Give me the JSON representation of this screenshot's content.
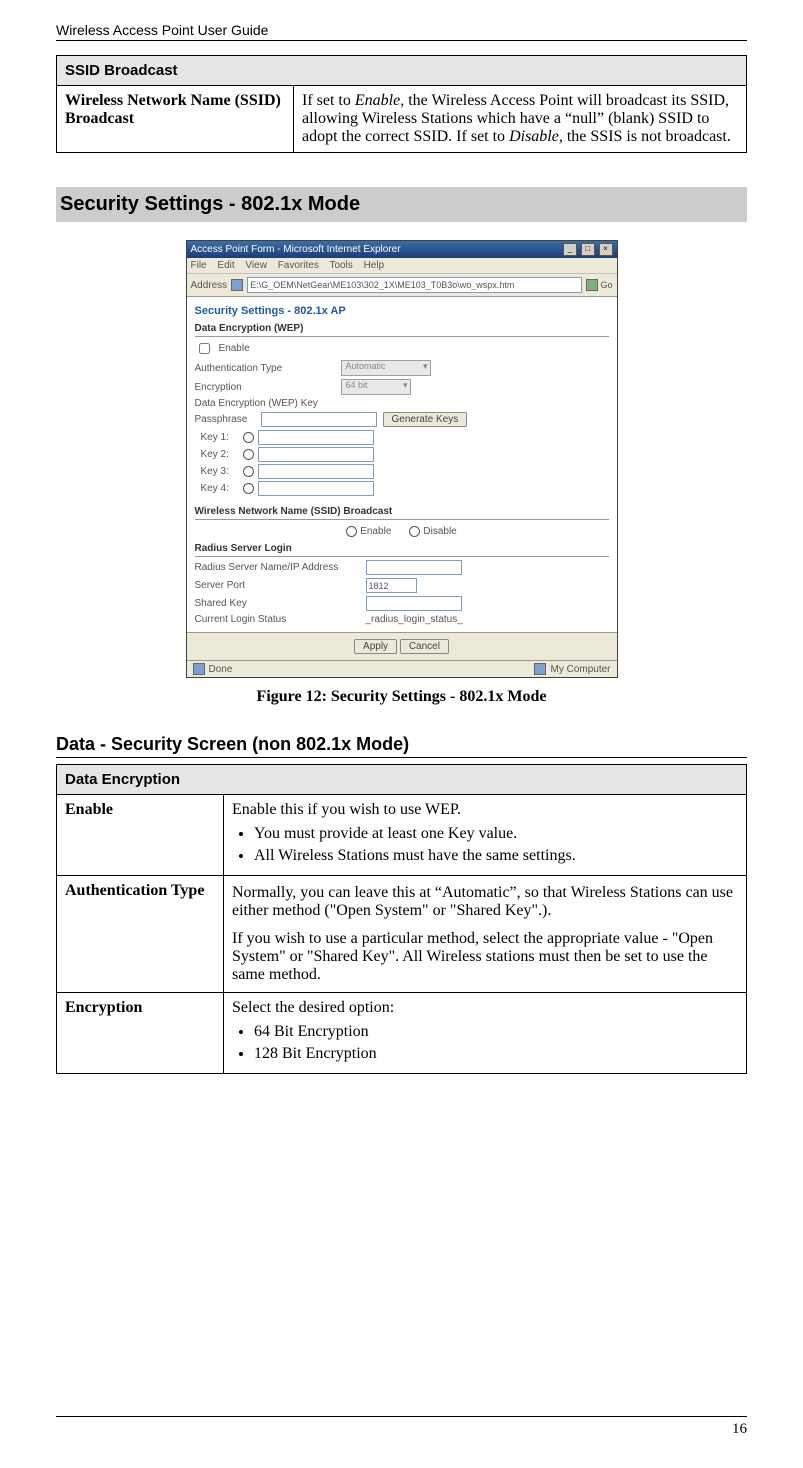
{
  "header": {
    "title": "Wireless Access Point User Guide"
  },
  "footer": {
    "page_number": "16"
  },
  "table1": {
    "section_header": "SSID Broadcast",
    "row": {
      "label": "Wireless Network Name (SSID) Broadcast",
      "desc1": "If set to ",
      "desc_em1": "Enable",
      "desc2": ", the Wireless Access Point will broadcast its SSID, allowing Wireless Stations which have a “null” (blank) SSID to adopt the correct SSID. If set to ",
      "desc_em2": "Disable",
      "desc3": ", the SSIS is not broadcast."
    }
  },
  "heading1": "Security Settings - 802.1x Mode",
  "figure_caption": "Figure 12: Security Settings - 802.1x Mode",
  "heading2": "Data - Security Screen (non 802.1x Mode)",
  "table2": {
    "section_header": "Data Encryption",
    "rows": {
      "enable": {
        "label": "Enable",
        "intro": "Enable this if you wish to use WEP.",
        "b1": "You must provide at least one Key value.",
        "b2": "All Wireless Stations must have the same settings."
      },
      "auth": {
        "label": "Authentication Type",
        "p1": "Normally, you can leave this at “Automatic”, so that Wireless Stations can use either method (\"Open System\" or \"Shared Key\".).",
        "p2": "If you wish to use a particular method, select the appropriate value - \"Open System\" or \"Shared Key\". All Wireless stations must then be set to use the same method."
      },
      "enc": {
        "label": "Encryption",
        "intro": "Select the desired option:",
        "b1": "64 Bit Encryption",
        "b2": "128 Bit Encryption"
      }
    }
  },
  "screenshot": {
    "title": "Access Point Form - Microsoft Internet Explorer",
    "menu": {
      "file": "File",
      "edit": "Edit",
      "view": "View",
      "favorites": "Favorites",
      "tools": "Tools",
      "help": "Help"
    },
    "address_label": "Address",
    "address_value": "E:\\G_OEM\\NetGear\\ME103\\302_1X\\ME103_T0B3o\\wo_wspx.htm",
    "go_label": "Go",
    "section_title": "Security Settings - 802.1x AP",
    "group_data_enc": "Data Encryption (WEP)",
    "enable_label": "Enable",
    "auth_type_label": "Authentication Type",
    "auth_value": "Automatic",
    "encryption_label": "Encryption",
    "encryption_value": "64 bit",
    "wep_key_label": "Data Encryption (WEP) Key",
    "passphrase_label": "Passphrase",
    "generate_btn": "Generate Keys",
    "key1": "Key 1:",
    "key2": "Key 2:",
    "key3": "Key 3:",
    "key4": "Key 4:",
    "group_ssid": "Wireless Network Name (SSID) Broadcast",
    "radio_enable": "Enable",
    "radio_disable": "Disable",
    "group_radius": "Radius Server Login",
    "rs_name": "Radius Server Name/IP Address",
    "rs_port": "Server Port",
    "rs_port_value": "1812",
    "rs_key": "Shared Key",
    "rs_status_label": "Current Login Status",
    "rs_status_value": "_radius_login_status_",
    "apply_btn": "Apply",
    "cancel_btn": "Cancel",
    "sb_done": "Done",
    "sb_zone": "My Computer"
  }
}
